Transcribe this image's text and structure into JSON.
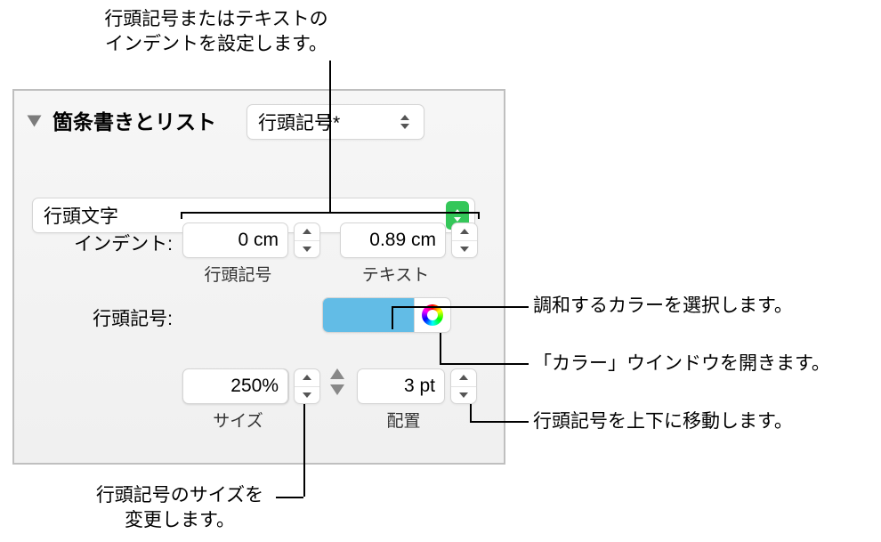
{
  "callouts": {
    "indent": "行頭記号またはテキストの\nインデントを設定します。",
    "size": "行頭記号のサイズを\n変更します。",
    "matchColor": "調和するカラーを選択します。",
    "colorWindow": "「カラー」ウインドウを開きます。",
    "alignMove": "行頭記号を上下に移動します。"
  },
  "section": {
    "title": "箇条書きとリスト"
  },
  "style_popup": {
    "value": "行頭記号*"
  },
  "bullet_type_popup": {
    "value": "行頭文字"
  },
  "indent": {
    "label": "インデント:",
    "bullet": {
      "value": "0 cm",
      "sublabel": "行頭記号"
    },
    "text": {
      "value": "0.89 cm",
      "sublabel": "テキスト"
    }
  },
  "bullet": {
    "label": "行頭記号:",
    "char_popup": {
      "value": "★"
    }
  },
  "size": {
    "value": "250%",
    "sublabel": "サイズ"
  },
  "align": {
    "value": "3 pt",
    "sublabel": "配置"
  }
}
